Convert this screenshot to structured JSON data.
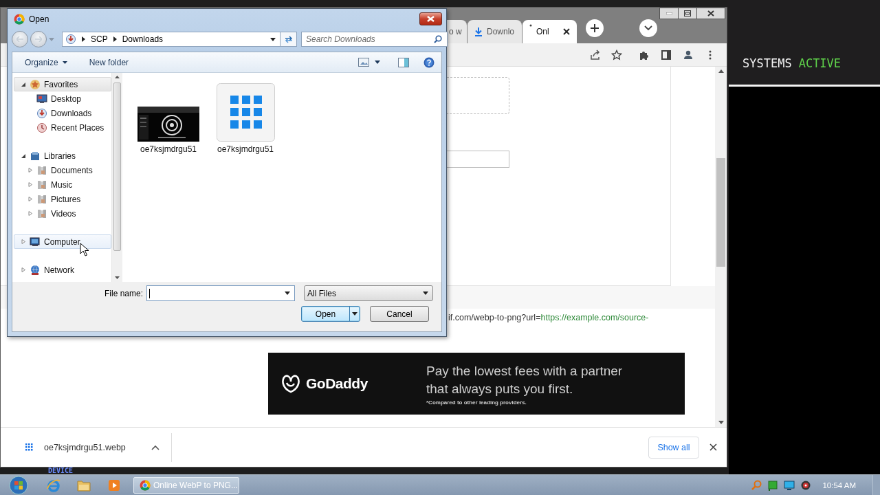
{
  "desktop": {
    "status_label": "SYSTEMS",
    "status_value": "ACTIVE",
    "device_label": "DEVICE"
  },
  "browser": {
    "tabs": [
      {
        "title": "o w",
        "kind": "page",
        "selected": false
      },
      {
        "title": "Downlo",
        "kind": "download",
        "selected": false
      },
      {
        "title": "Onl",
        "kind": "loading",
        "selected": true
      }
    ],
    "page": {
      "url_prefix": "if.com/webp-to-png?url=",
      "url_link": "https://example.com/source-",
      "ad": {
        "brand": "GoDaddy",
        "headline": "Pay the lowest fees with a partner that always puts you first.",
        "footnote": "*Compared to other leading providers."
      }
    },
    "download_bar": {
      "file": "oe7ksjmdrgu51.webp",
      "show_all": "Show all"
    }
  },
  "dialog": {
    "title": "Open",
    "breadcrumb": [
      "SCP",
      "Downloads"
    ],
    "search": {
      "placeholder": "Search Downloads"
    },
    "toolbar": [
      {
        "label": "Organize",
        "kind": "menu"
      },
      {
        "label": "New folder",
        "kind": "plain"
      }
    ],
    "nav_tree": [
      {
        "label": "Favorites",
        "kind": "favorites",
        "expanded": true,
        "selected": true,
        "hovered": false,
        "children": [
          {
            "label": "Desktop",
            "kind": "desktop",
            "selected": false,
            "hovered": false
          },
          {
            "label": "Downloads",
            "kind": "downloads",
            "selected": false,
            "hovered": false
          },
          {
            "label": "Recent Places",
            "kind": "recent",
            "selected": false,
            "hovered": false
          }
        ]
      },
      {
        "label": "Libraries",
        "kind": "libraries",
        "expanded": true,
        "selected": false,
        "hovered": false,
        "children": [
          {
            "label": "Documents",
            "kind": "library",
            "expanded": false,
            "selected": false,
            "hovered": false
          },
          {
            "label": "Music",
            "kind": "library",
            "expanded": false,
            "selected": false,
            "hovered": false
          },
          {
            "label": "Pictures",
            "kind": "library",
            "expanded": false,
            "selected": false,
            "hovered": false
          },
          {
            "label": "Videos",
            "kind": "library",
            "expanded": false,
            "selected": false,
            "hovered": false
          }
        ]
      },
      {
        "label": "Computer",
        "kind": "computer",
        "expanded": false,
        "selected": false,
        "hovered": true
      },
      {
        "label": "Network",
        "kind": "network",
        "expanded": false,
        "selected": false,
        "hovered": false
      }
    ],
    "files": [
      {
        "name": "oe7ksjmdrgu51",
        "kind": "picture"
      },
      {
        "name": "oe7ksjmdrgu51",
        "kind": "grid"
      }
    ],
    "file_name_label": "File name:",
    "file_type": "All Files",
    "buttons": [
      {
        "label": "Open",
        "kind": "split",
        "default": true
      },
      {
        "label": "Cancel",
        "kind": "plain",
        "default": false
      }
    ]
  },
  "taskbar": {
    "tasks": [
      {
        "label": "Online WebP to PNG...",
        "selected": true
      }
    ],
    "clock": "10:54 AM"
  }
}
